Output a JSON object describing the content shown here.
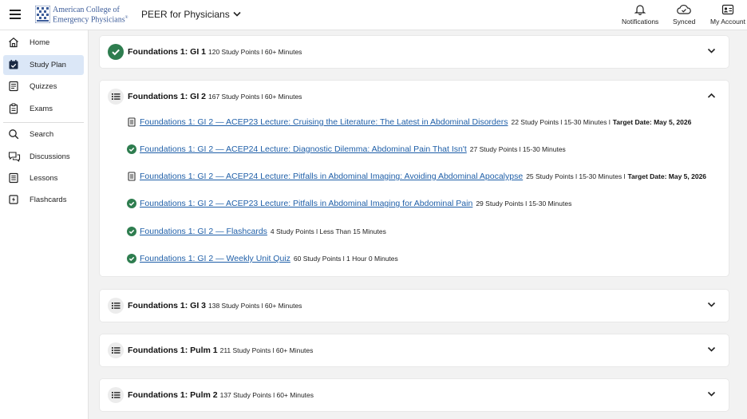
{
  "header": {
    "logo_line1": "American College of",
    "logo_line2": "Emergency Physicians",
    "logo_mark": "®",
    "product": "PEER for Physicians",
    "notifications_label": "Notifications",
    "synced_label": "Synced",
    "account_label": "My Account"
  },
  "sidebar": {
    "items": [
      {
        "label": "Home",
        "icon": "home-icon"
      },
      {
        "label": "Study Plan",
        "icon": "calendar-check-icon",
        "active": true
      },
      {
        "label": "Quizzes",
        "icon": "quiz-icon"
      },
      {
        "label": "Exams",
        "icon": "exam-clipboard-icon"
      },
      {
        "label": "Search",
        "icon": "search-icon"
      },
      {
        "label": "Discussions",
        "icon": "discussions-icon"
      },
      {
        "label": "Lessons",
        "icon": "lessons-icon"
      },
      {
        "label": "Flashcards",
        "icon": "flashcards-icon"
      }
    ]
  },
  "colors": {
    "accent": "#dbe7f7",
    "link": "#1f5fa8",
    "complete": "#2e7d4f"
  },
  "modules": [
    {
      "title": "Foundations 1: GI 1",
      "meta": "120 Study Points l 60+ Minutes",
      "status": "complete",
      "expanded": false
    },
    {
      "title": "Foundations 1: GI 2",
      "meta": "167 Study Points l 60+ Minutes",
      "status": "in-progress",
      "expanded": true,
      "items": [
        {
          "title": "Foundations 1: GI 2 — ACEP23 Lecture: Cruising the Literature: The Latest in Abdominal Disorders",
          "meta": "22 Study Points l  15-30 Minutes l",
          "target": "Target Date: May 5, 2026",
          "done": false
        },
        {
          "title": "Foundations 1: GI 2 — ACEP24 Lecture: Diagnostic Dilemma: Abdominal Pain That Isn't",
          "meta": "27 Study Points l  15-30 Minutes",
          "target": "",
          "done": true
        },
        {
          "title": "Foundations 1: GI 2 — ACEP24 Lecture: Pitfalls in Abdominal Imaging: Avoiding Abdominal Apocalypse",
          "meta": "25 Study Points l  15-30 Minutes l",
          "target": "Target Date: May 5, 2026",
          "done": false
        },
        {
          "title": "Foundations 1: GI 2 — ACEP23 Lecture: Pitfalls in Abdominal Imaging for Abdominal Pain",
          "meta": "29 Study Points l  15-30 Minutes",
          "target": "",
          "done": true
        },
        {
          "title": "Foundations 1: GI 2 — Flashcards",
          "meta": "4 Study Points l  Less Than 15 Minutes",
          "target": "",
          "done": true
        },
        {
          "title": "Foundations 1: GI 2 — Weekly Unit Quiz",
          "meta": "60 Study Points l  1 Hour 0 Minutes",
          "target": "",
          "done": true
        }
      ]
    },
    {
      "title": "Foundations 1: GI 3",
      "meta": "138 Study Points l 60+ Minutes",
      "status": "in-progress",
      "expanded": false
    },
    {
      "title": "Foundations 1: Pulm 1",
      "meta": "211 Study Points l 60+ Minutes",
      "status": "in-progress",
      "expanded": false
    },
    {
      "title": "Foundations 1: Pulm 2",
      "meta": "137 Study Points l 60+ Minutes",
      "status": "in-progress",
      "expanded": false
    }
  ]
}
